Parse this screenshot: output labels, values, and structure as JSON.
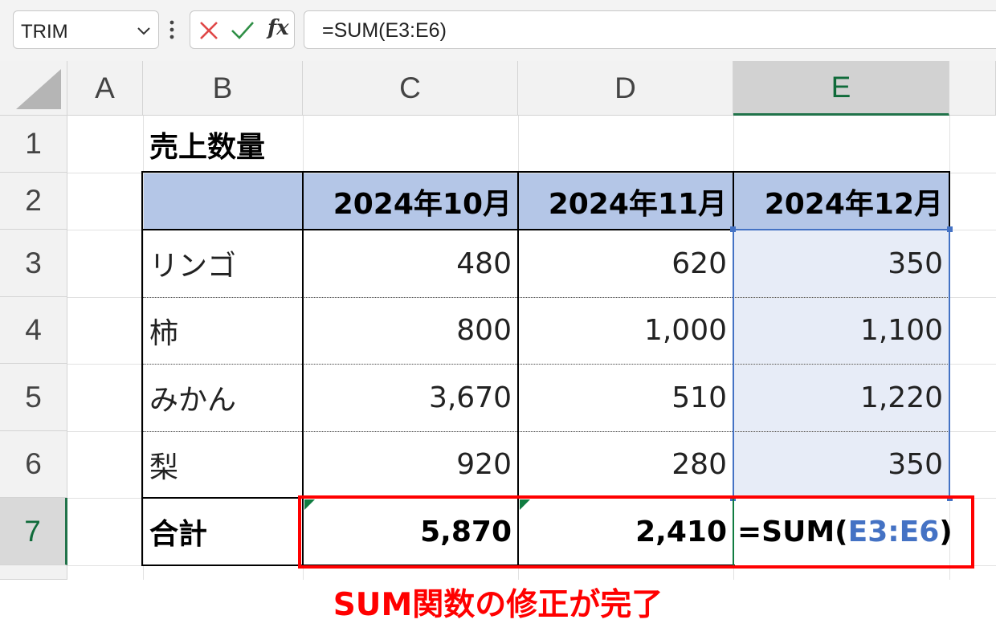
{
  "formula_bar": {
    "name_box": "TRIM",
    "cancel_icon": "x-icon",
    "enter_icon": "checkmark-icon",
    "fx_label": "fx",
    "formula_text": "=SUM(E3:E6)"
  },
  "columns": [
    "A",
    "B",
    "C",
    "D",
    "E"
  ],
  "rows": [
    "1",
    "2",
    "3",
    "4",
    "5",
    "6",
    "7"
  ],
  "sheet": {
    "title": "売上数量",
    "headers": [
      "2024年10月",
      "2024年11月",
      "2024年12月"
    ],
    "items": [
      {
        "name": "リンゴ",
        "c": "480",
        "d": "620",
        "e": "350"
      },
      {
        "name": "柿",
        "c": "800",
        "d": "1,000",
        "e": "1,100"
      },
      {
        "name": "みかん",
        "c": "3,670",
        "d": "510",
        "e": "1,220"
      },
      {
        "name": "梨",
        "c": "920",
        "d": "280",
        "e": "350"
      }
    ],
    "total_label": "合計",
    "total_c": "5,870",
    "total_d": "2,410",
    "editing_formula": {
      "prefix": "=SUM(",
      "range": "E3:E6",
      "suffix": ")"
    }
  },
  "caption": "SUM関数の修正が完了",
  "colors": {
    "accent_green": "#107c41",
    "header_fill": "#b4c6e7",
    "range_blue": "#4472c4",
    "annotation_red": "#ff0000"
  }
}
